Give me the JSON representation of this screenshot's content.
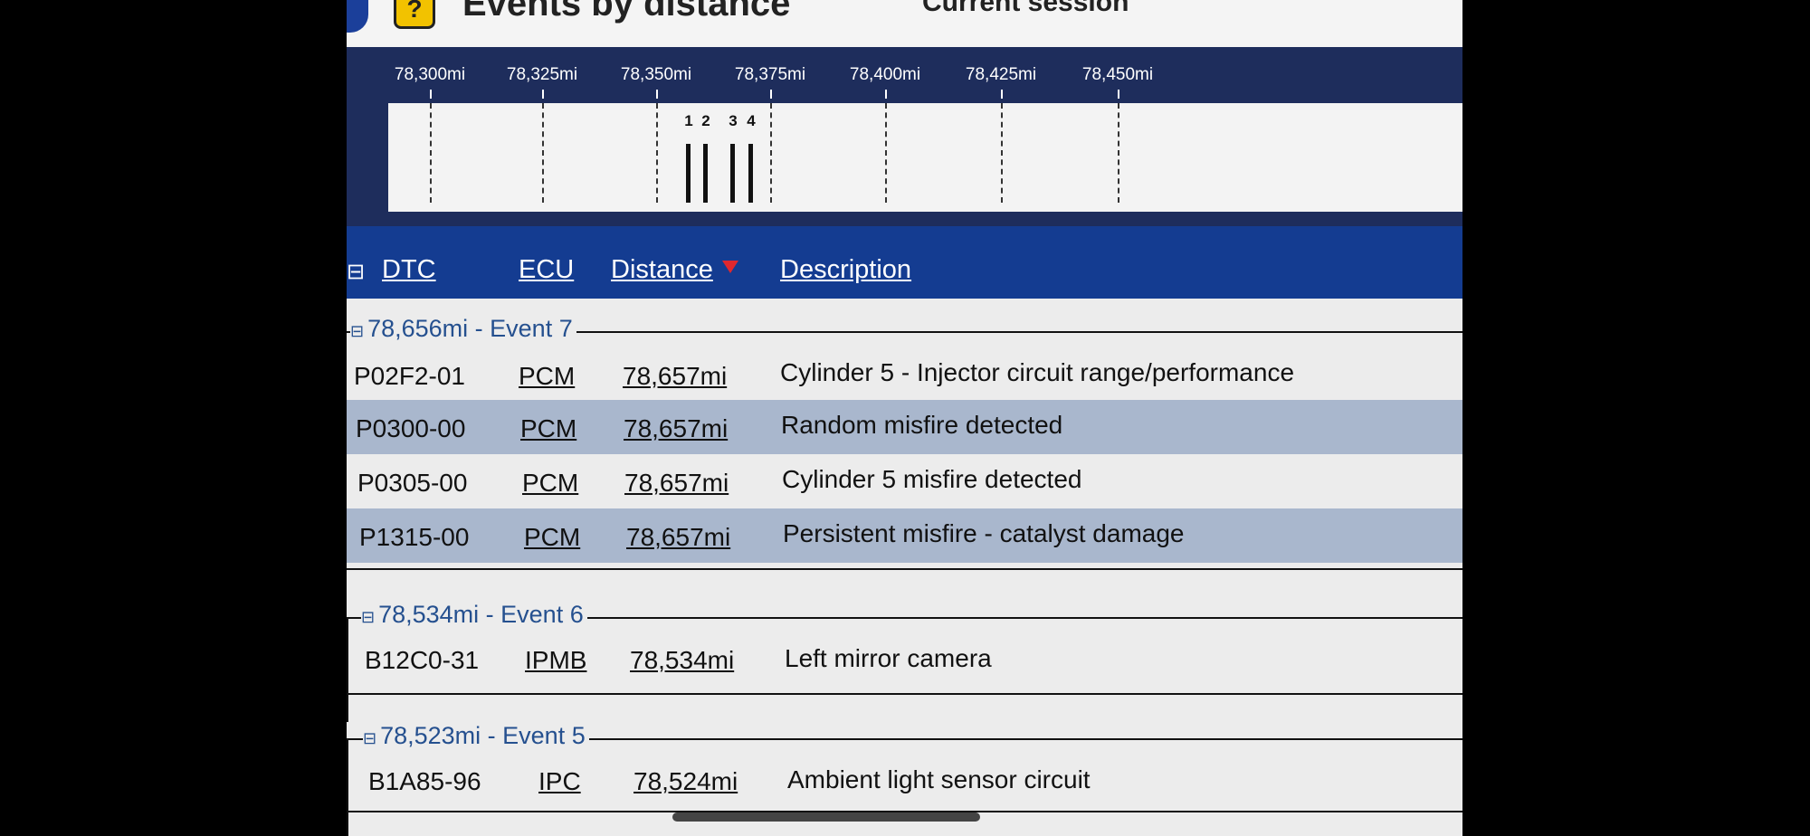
{
  "panel": {
    "title": "Events by distance",
    "subtitle": "Current session"
  },
  "timeline": {
    "ticks": [
      "78,300mi",
      "78,325mi",
      "78,350mi",
      "78,375mi",
      "78,400mi",
      "78,425mi",
      "78,450mi"
    ],
    "event_markers": [
      "1",
      "2",
      "3",
      "4"
    ]
  },
  "columns": {
    "dtc": "DTC",
    "ecu": "ECU",
    "distance": "Distance",
    "description": "Description"
  },
  "groups": [
    {
      "title": "78,656mi - Event 7",
      "rows": [
        {
          "dtc": "P02F2-01",
          "ecu": "PCM",
          "distance": "78,657mi",
          "description": "Cylinder 5 - Injector circuit range/performance"
        },
        {
          "dtc": "P0300-00",
          "ecu": "PCM",
          "distance": "78,657mi",
          "description": "Random misfire detected"
        },
        {
          "dtc": "P0305-00",
          "ecu": "PCM",
          "distance": "78,657mi",
          "description": "Cylinder 5 misfire detected"
        },
        {
          "dtc": "P1315-00",
          "ecu": "PCM",
          "distance": "78,657mi",
          "description": "Persistent misfire - catalyst damage"
        }
      ]
    },
    {
      "title": "78,534mi - Event 6",
      "rows": [
        {
          "dtc": "B12C0-31",
          "ecu": "IPMB",
          "distance": "78,534mi",
          "description": "Left mirror camera"
        }
      ]
    },
    {
      "title": "78,523mi - Event 5",
      "rows": [
        {
          "dtc": "B1A85-96",
          "ecu": "IPC",
          "distance": "78,524mi",
          "description": "Ambient light sensor circuit"
        }
      ]
    }
  ]
}
